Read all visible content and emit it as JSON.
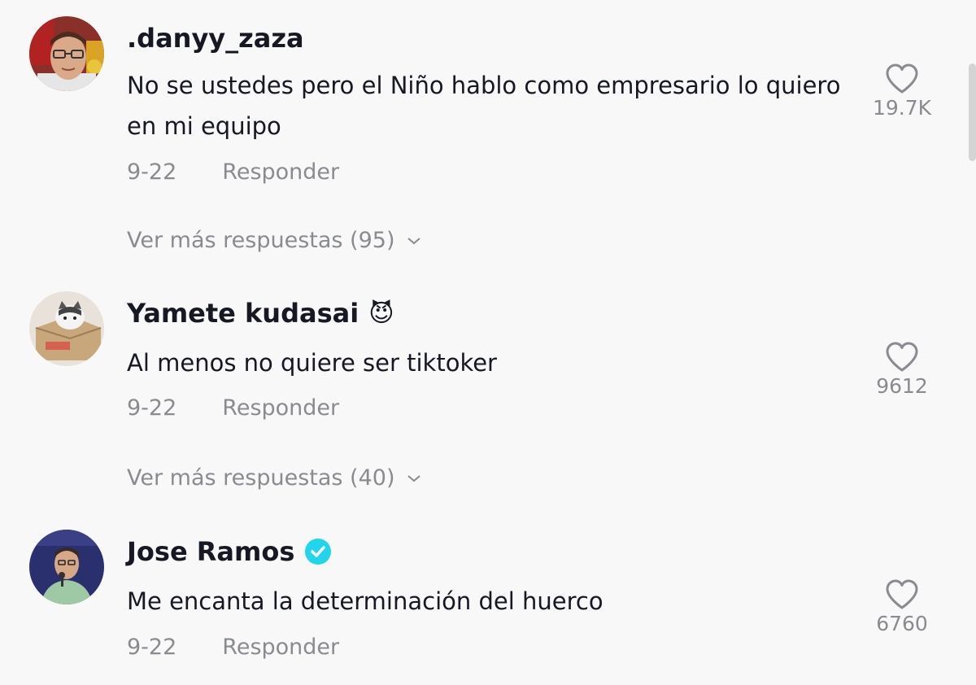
{
  "comments": [
    {
      "username": ".danyy_zaza",
      "text": "No se ustedes pero el Niño hablo como empresario lo quiero en mi equipo",
      "date": "9-22",
      "reply_label": "Responder",
      "likes": "19.7K",
      "more_replies": "Ver más respuestas (95)",
      "avatar_icon": "man-with-glasses-avatar"
    },
    {
      "username": "Yamete kudasai",
      "username_suffix": "😈",
      "text": "Al menos no quiere ser tiktoker",
      "date": "9-22",
      "reply_label": "Responder",
      "likes": "9612",
      "more_replies": "Ver más respuestas (40)",
      "avatar_icon": "cat-in-box-avatar"
    },
    {
      "username": "Jose Ramos",
      "verified": true,
      "text": "Me encanta la determinación del huerco",
      "date": "9-22",
      "reply_label": "Responder",
      "likes": "6760",
      "avatar_icon": "man-with-microphone-avatar"
    }
  ],
  "colors": {
    "background": "#f8f8f8",
    "text": "#161823",
    "muted": "#8a8b91",
    "verified": "#20d5ec"
  }
}
